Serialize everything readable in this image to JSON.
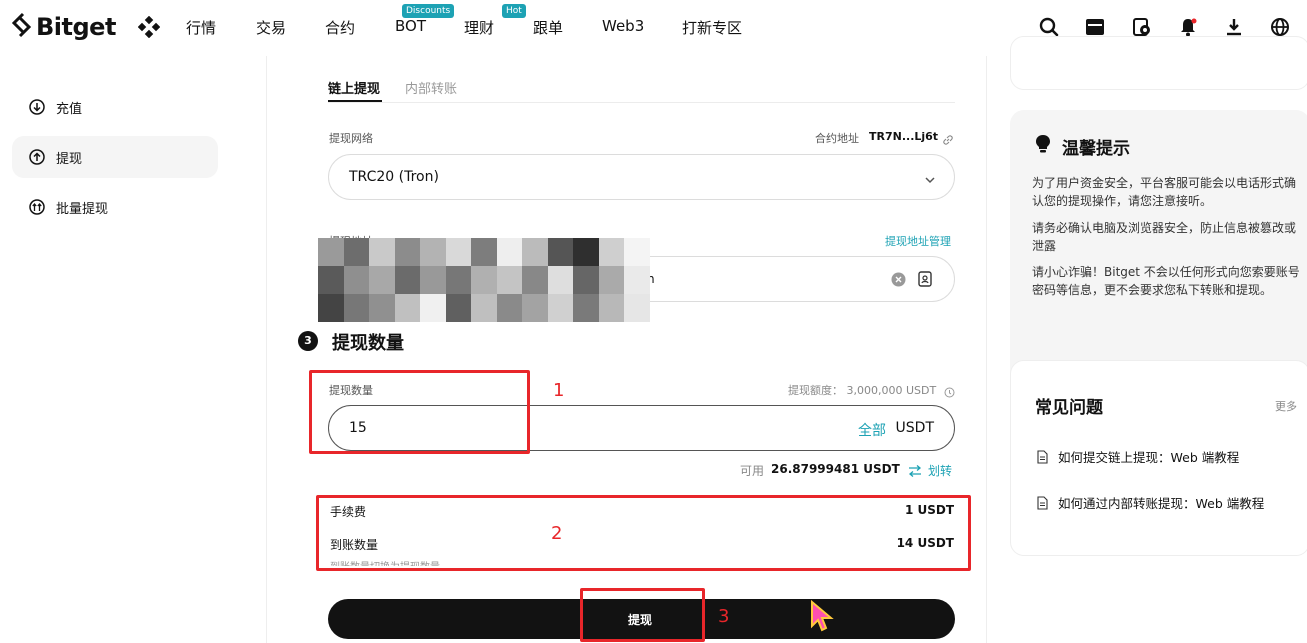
{
  "header": {
    "logo_text": "Bitget",
    "nav": [
      {
        "label": "行情"
      },
      {
        "label": "交易"
      },
      {
        "label": "合约"
      },
      {
        "label": "BOT",
        "badge": "Discounts"
      },
      {
        "label": "理财"
      },
      {
        "label": "跟单",
        "badge": "Hot"
      },
      {
        "label": "Web3"
      },
      {
        "label": "打新专区"
      }
    ],
    "icons": [
      "search-icon",
      "wallet-icon",
      "assets-icon",
      "bell-icon",
      "download-icon",
      "globe-icon"
    ]
  },
  "sidebar": {
    "items": [
      {
        "label": "充值",
        "icon": "deposit-icon"
      },
      {
        "label": "提现",
        "icon": "withdraw-icon",
        "active": true
      },
      {
        "label": "批量提现",
        "icon": "batch-withdraw-icon"
      }
    ]
  },
  "main": {
    "tabs": [
      {
        "label": "链上提现",
        "active": true
      },
      {
        "label": "内部转账",
        "active": false
      }
    ],
    "network": {
      "label": "提现网络",
      "contract_label": "合约地址",
      "contract_value": "TR7N...Lj6t",
      "selected": "TRC20 (Tron)"
    },
    "address": {
      "label": "提现地址",
      "manage_link": "提现地址管理",
      "value_tail": "n"
    },
    "amount_section": {
      "step_number": "3",
      "title": "提现数量",
      "label": "提现数量",
      "limit_text": "提现额度：  3,000,000 USDT",
      "value": "15",
      "all_label": "全部",
      "unit": "USDT",
      "available_prefix": "可用",
      "available_value": "26.87999481 USDT",
      "transfer_label": "划转"
    },
    "fee": {
      "fee_label": "手续费",
      "fee_value": "1 USDT",
      "receive_label": "到账数量",
      "receive_value": "14 USDT",
      "switch_hint": "到账数量切换为提现数量"
    },
    "submit_label": "提现"
  },
  "annotations": {
    "box1": "1",
    "box2": "2",
    "box3": "3"
  },
  "tips": {
    "title": "温馨提示",
    "items": [
      "为了用户资金安全，平台客服可能会以电话形式确认您的提现操作，请您注意接听。",
      "请务必确认电脑及浏览器安全，防止信息被篡改或泄露",
      "请小心诈骗！Bitget 不会以任何形式向您索要账号密码等信息，更不会要求您私下转账和提现。"
    ]
  },
  "faq": {
    "title": "常见问题",
    "more": "更多",
    "items": [
      "如何提交链上提现：Web 端教程",
      "如何通过内部转账提现：Web 端教程"
    ]
  },
  "colors": {
    "accent": "#1da2b4",
    "annotation_red": "#e8262a",
    "primary_dark": "#121212"
  }
}
